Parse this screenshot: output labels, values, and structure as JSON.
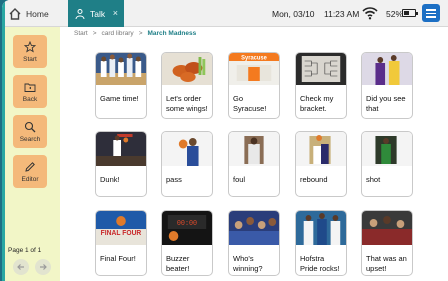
{
  "tabs": {
    "home": "Home",
    "talk": "Talk",
    "close": "×"
  },
  "status": {
    "date": "Mon, 03/10",
    "time": "11:23 AM",
    "battery": "52%",
    "battery_level": 0.52
  },
  "sidebar": {
    "items": [
      {
        "label": "Start",
        "icon": "star-icon"
      },
      {
        "label": "Back",
        "icon": "folder-back-icon"
      },
      {
        "label": "Search",
        "icon": "search-icon"
      },
      {
        "label": "Editor",
        "icon": "pencil-icon"
      }
    ],
    "page_label": "Page 1 of 1"
  },
  "breadcrumb": {
    "root": "Start",
    "sep": ">",
    "library": "card library",
    "current": "March Madness"
  },
  "cards": [
    {
      "label": "Game time!",
      "icon": "basketball-team-photo"
    },
    {
      "label": "Let's order some wings!",
      "icon": "wings-photo"
    },
    {
      "label": "Go Syracuse!",
      "icon": "syracuse-photo"
    },
    {
      "label": "Check my bracket.",
      "icon": "bracket-photo"
    },
    {
      "label": "Did you see that",
      "icon": "player-photo"
    },
    {
      "label": "Dunk!",
      "icon": "dunk-photo"
    },
    {
      "label": "pass",
      "icon": "pass-photo"
    },
    {
      "label": "foul",
      "icon": "foul-photo"
    },
    {
      "label": "rebound",
      "icon": "rebound-photo"
    },
    {
      "label": "shot",
      "icon": "shot-photo"
    },
    {
      "label": "Final Four!",
      "icon": "final-four-photo"
    },
    {
      "label": "Buzzer beater!",
      "icon": "scoreboard-photo"
    },
    {
      "label": "Who's winning?",
      "icon": "crowd-photo"
    },
    {
      "label": "Hofstra Pride rocks!",
      "icon": "hofstra-photo"
    },
    {
      "label": "That was an upset!",
      "icon": "upset-photo"
    }
  ],
  "colors": {
    "accent": "#1f7f87",
    "sidebar": "#f2f6c7",
    "side_button": "#f4b97a",
    "menu": "#1c6fc4"
  }
}
